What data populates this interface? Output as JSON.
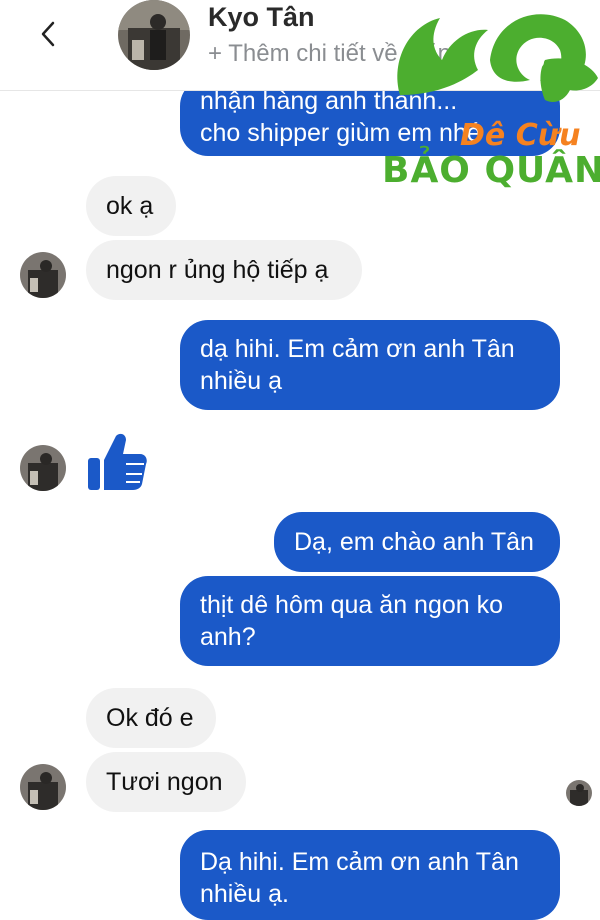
{
  "header": {
    "contact_name": "Kyo Tân",
    "add_details": "+ Thêm chi tiết về ...ăn"
  },
  "logo": {
    "line1": "Dê Cừu",
    "line2": "BẢO QUÂN",
    "green": "#4cae2f",
    "orange": "#f58220"
  },
  "messages": [
    {
      "from": "me",
      "text": "nhận hàng anh thanh...\ncho shipper giùm em nhé"
    },
    {
      "from": "them",
      "text": "ok ạ"
    },
    {
      "from": "them",
      "text": "ngon r ủng hộ tiếp ạ"
    },
    {
      "from": "me",
      "text": "dạ hihi. Em cảm ơn anh Tân\nnhiều ạ"
    },
    {
      "from": "them",
      "sticker": "thumbs-up"
    },
    {
      "from": "me",
      "text": "Dạ, em chào anh Tân"
    },
    {
      "from": "me",
      "text": "thịt dê hôm qua ăn ngon ko\nanh?"
    },
    {
      "from": "them",
      "text": "Ok đó e"
    },
    {
      "from": "them",
      "text": "Tươi ngon"
    },
    {
      "from": "me",
      "text": "Dạ hihi. Em cảm ơn anh Tân\nnhiều ạ."
    }
  ],
  "colors": {
    "outgoing_bubble": "#1b59c8",
    "incoming_bubble": "#f1f1f1",
    "thumbs_up": "#1b59c8"
  }
}
